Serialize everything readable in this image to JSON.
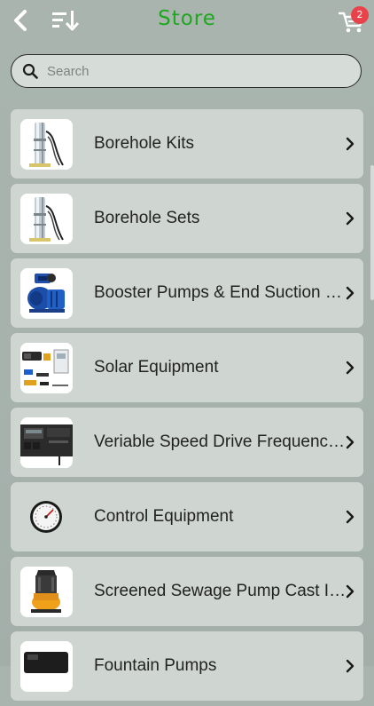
{
  "header": {
    "title": "Store",
    "title_color": "#1ea81e",
    "back_icon": "chevron-left-icon",
    "sort_icon": "sort-descending-icon",
    "cart_icon": "shopping-cart-icon",
    "cart_count": "2",
    "badge_color": "#e8424a"
  },
  "search": {
    "placeholder": "Search",
    "value": ""
  },
  "categories": [
    {
      "label": "Borehole Kits",
      "thumb": "borehole-pump"
    },
    {
      "label": "Borehole Sets",
      "thumb": "borehole-pump"
    },
    {
      "label": "Booster Pumps & End Suction Pumps",
      "thumb": "booster-pump"
    },
    {
      "label": "Solar Equipment",
      "thumb": "solar-kit"
    },
    {
      "label": "Veriable Speed Drive Frequency Inverters",
      "thumb": "vsd-drive"
    },
    {
      "label": "Control Equipment",
      "thumb": "pressure-gauge"
    },
    {
      "label": "Screened Sewage Pump Cast Iron",
      "thumb": "sewage-pump"
    },
    {
      "label": "Fountain Pumps",
      "thumb": "fountain-pump"
    }
  ]
}
